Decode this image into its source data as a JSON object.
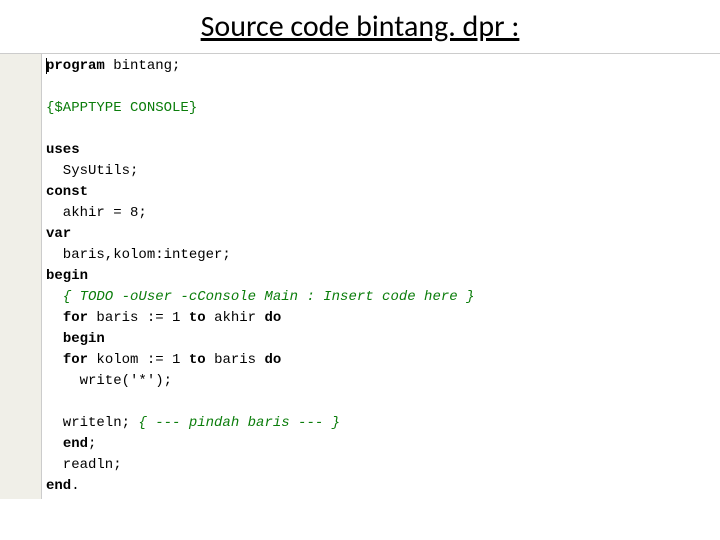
{
  "title": "Source code bintang. dpr :",
  "code": {
    "l1_kw": "program",
    "l1_rest": " bintang;",
    "l2_dir": "{$APPTYPE CONSOLE}",
    "l4_kw": "uses",
    "l5": "  SysUtils;",
    "l6_kw": "const",
    "l7": "  akhir = 8;",
    "l8_kw": "var",
    "l9": "  baris,kolom:integer;",
    "l10_kw": "begin",
    "l11_cmt": "  { TODO -oUser -cConsole Main : Insert code here }",
    "l12a_sp": "  ",
    "l12a_kw1": "for",
    "l12a_mid": " baris := 1 ",
    "l12a_kw2": "to",
    "l12a_mid2": " akhir ",
    "l12a_kw3": "do",
    "l13_sp": "  ",
    "l13_kw": "begin",
    "l14_sp": "  ",
    "l14_kw1": "for",
    "l14_mid": " kolom := 1 ",
    "l14_kw2": "to",
    "l14_mid2": " baris ",
    "l14_kw3": "do",
    "l15": "    write('*');",
    "l17a": "  writeln; ",
    "l17b_cmt": "{ --- pindah baris --- }",
    "l18_sp": "  ",
    "l18_kw": "end",
    "l18_rest": ";",
    "l19": "  readln;",
    "l20_kw": "end",
    "l20_rest": "."
  }
}
